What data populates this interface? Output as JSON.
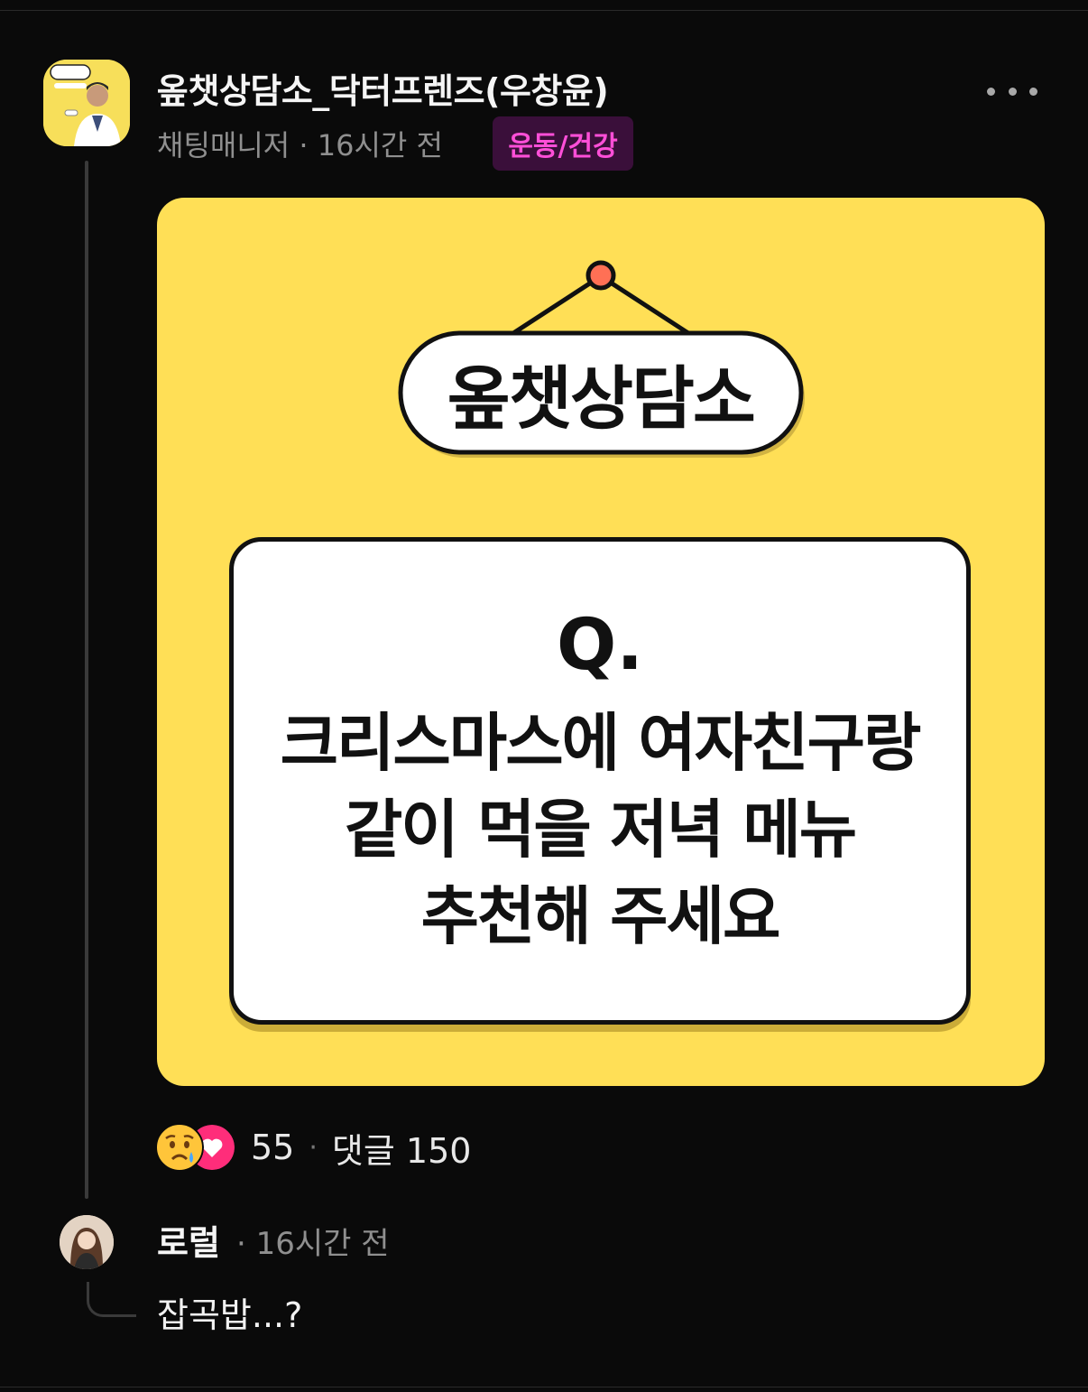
{
  "post": {
    "author": "옾챗상담소_닥터프렌즈(우창윤)",
    "role": "채팅매니저",
    "time": "16시간 전",
    "category": "운동/건강",
    "image": {
      "sign_label": "옾챗상담소",
      "question_mark": "Q.",
      "question_lines": [
        "크리스마스에 여자친구랑",
        "같이 먹을 저녁 메뉴",
        "추천해 주세요"
      ]
    },
    "reaction_count": "55",
    "comment_label": "댓글 150"
  },
  "reply": {
    "author": "로럴",
    "time": "16시간 전",
    "body": "잡곡밥...?"
  },
  "colors": {
    "background": "#0a0a0a",
    "card_yellow": "#ffdf56",
    "tag_bg": "#3a0f3a",
    "tag_text": "#ff4fd8",
    "heart": "#ff2d7a"
  },
  "icons": [
    "more-icon",
    "sad-reaction-icon",
    "heart-reaction-icon"
  ]
}
